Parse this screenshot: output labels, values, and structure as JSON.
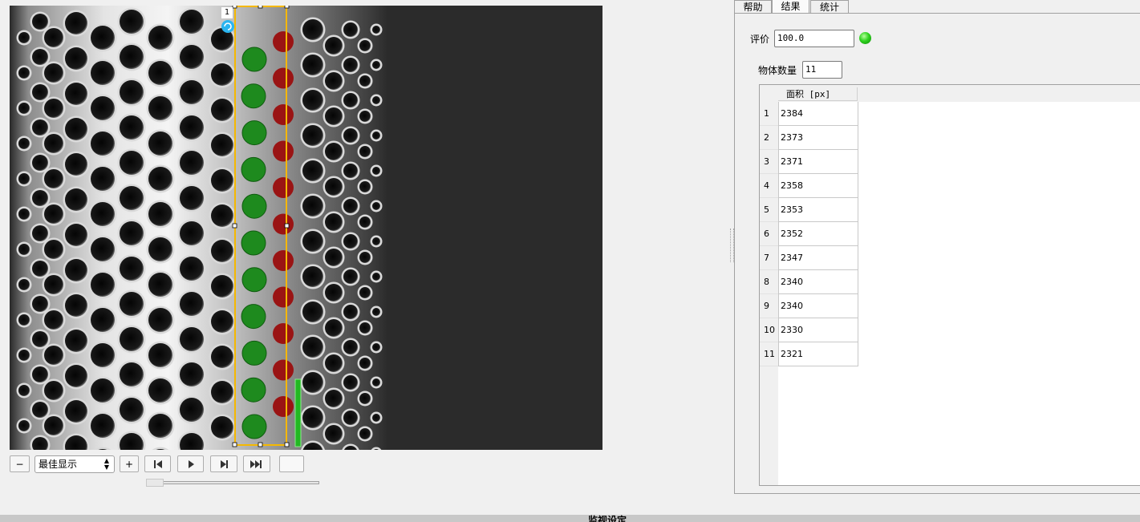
{
  "viewer": {
    "roi_index": "1",
    "detected_count": 11
  },
  "controls": {
    "zoom_out_label": "−",
    "zoom_in_label": "+",
    "zoom_mode": "最佳显示",
    "first_frame_icon": "skip-to-start-icon",
    "play_icon": "play-icon",
    "next_frame_icon": "step-forward-icon",
    "last_frame_icon": "skip-to-end-icon"
  },
  "panel": {
    "tabs": [
      {
        "label": "帮助"
      },
      {
        "label": "结果",
        "active": true
      },
      {
        "label": "统计"
      }
    ],
    "evaluation": {
      "label": "评价",
      "value": "100.0",
      "status_color": "#2fd21f"
    },
    "object_count": {
      "label": "物体数量",
      "value": "11"
    },
    "table": {
      "column_header": "面积 [px]",
      "rows": [
        {
          "index": "1",
          "value": "2384"
        },
        {
          "index": "2",
          "value": "2373"
        },
        {
          "index": "3",
          "value": "2371"
        },
        {
          "index": "4",
          "value": "2358"
        },
        {
          "index": "5",
          "value": "2353"
        },
        {
          "index": "6",
          "value": "2352"
        },
        {
          "index": "7",
          "value": "2347"
        },
        {
          "index": "8",
          "value": "2340"
        },
        {
          "index": "9",
          "value": "2340"
        },
        {
          "index": "10",
          "value": "2330"
        },
        {
          "index": "11",
          "value": "2321"
        }
      ]
    }
  },
  "bottom_bar": {
    "label": "监视设定"
  },
  "colors": {
    "roi_border": "#f5b800",
    "detected_good": "#1e8a1e",
    "detected_bad": "#9a1414",
    "image_background": "#2a2a2a"
  }
}
